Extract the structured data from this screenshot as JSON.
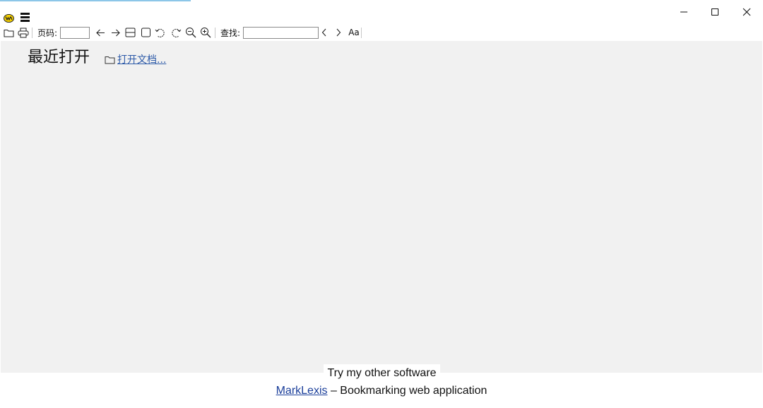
{
  "window": {
    "app_icon": "sumatra-pdf-logo",
    "menu_icon": "hamburger-menu-icon",
    "controls": [
      "minimize-icon",
      "maximize-icon",
      "close-icon"
    ]
  },
  "toolbar": {
    "page_label": "页码:",
    "page_value": "",
    "find_label": "查找:",
    "find_value": "",
    "icons": [
      "open-folder-icon",
      "print-icon",
      "prev-page-icon",
      "next-page-icon",
      "fit-page-icon",
      "fit-width-icon",
      "rotate-left-icon",
      "rotate-right-icon",
      "zoom-out-icon",
      "zoom-in-icon",
      "find-prev-icon",
      "find-next-icon",
      "match-case-icon"
    ],
    "match_case_glyph": "Aa"
  },
  "home": {
    "recent_title": "最近打开",
    "open_document_label": "打开文档..."
  },
  "promo": {
    "tab_text": "Try my other software",
    "link_text": "MarkLexis",
    "description": " – Bookmarking web application"
  },
  "colors": {
    "background": "#f1f1f1",
    "link": "#2d5aa8",
    "accent_line": "#8cc6e8"
  }
}
